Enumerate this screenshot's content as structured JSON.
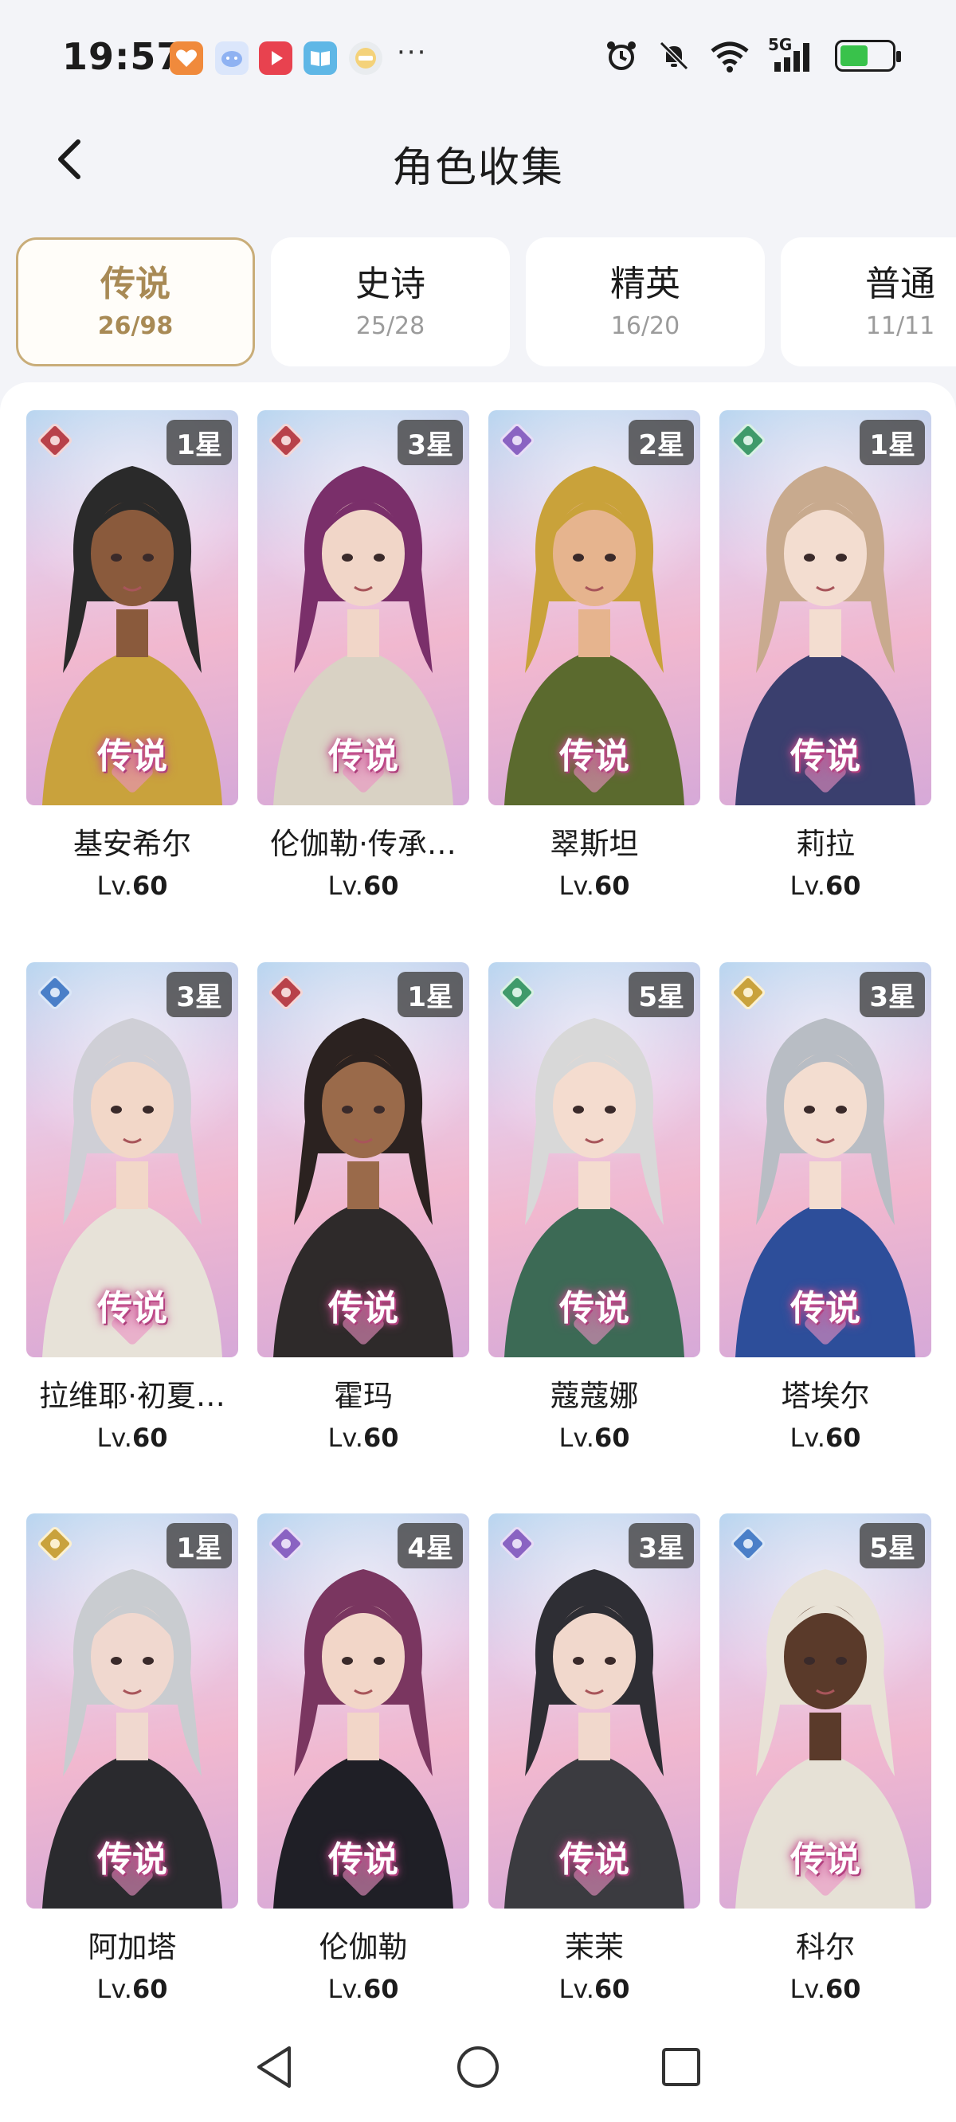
{
  "status_bar": {
    "time": "19:57",
    "notification_icons": [
      "favorite-app-icon",
      "chat-app-icon",
      "video-app-icon",
      "book-app-icon",
      "game-app-icon"
    ],
    "more": "···",
    "signal_label": "5G"
  },
  "header": {
    "title": "角色收集"
  },
  "tabs": [
    {
      "label": "传说",
      "count": "26/98",
      "active": true
    },
    {
      "label": "史诗",
      "count": "25/28",
      "active": false
    },
    {
      "label": "精英",
      "count": "16/20",
      "active": false
    },
    {
      "label": "普通",
      "count": "11/11",
      "active": false
    }
  ],
  "rarity_label": "传说",
  "level_prefix": "Lv.",
  "characters": [
    {
      "name": "基安希尔",
      "stars": "1星",
      "level": "60",
      "element": "crimson",
      "skin": "#8a5a3c",
      "hair": "#2a2a2a",
      "outfit": "#c9a23c"
    },
    {
      "name": "伦伽勒·传承…",
      "stars": "3星",
      "level": "60",
      "element": "crimson",
      "skin": "#f1d6c8",
      "hair": "#7a2f6a",
      "outfit": "#d9d2c4"
    },
    {
      "name": "翠斯坦",
      "stars": "2星",
      "level": "60",
      "element": "violet",
      "skin": "#e6b48e",
      "hair": "#c9a23a",
      "outfit": "#5b6a2e"
    },
    {
      "name": "莉拉",
      "stars": "1星",
      "level": "60",
      "element": "green",
      "skin": "#f3ddd0",
      "hair": "#c8aa8e",
      "outfit": "#3a3f6e"
    },
    {
      "name": "拉维耶·初夏…",
      "stars": "3星",
      "level": "60",
      "element": "blue",
      "skin": "#f2d7c8",
      "hair": "#cfcfd6",
      "outfit": "#e7e2d8"
    },
    {
      "name": "霍玛",
      "stars": "1星",
      "level": "60",
      "element": "crimson",
      "skin": "#9a6a4a",
      "hair": "#2b2220",
      "outfit": "#2e2a2a"
    },
    {
      "name": "蔻蔻娜",
      "stars": "5星",
      "level": "60",
      "element": "green",
      "skin": "#f4dccf",
      "hair": "#d8d8d8",
      "outfit": "#3c6a55"
    },
    {
      "name": "塔埃尔",
      "stars": "3星",
      "level": "60",
      "element": "gold",
      "skin": "#f3ddd0",
      "hair": "#b8bdc4",
      "outfit": "#2d4e9a"
    },
    {
      "name": "阿加塔",
      "stars": "1星",
      "level": "60",
      "element": "gold",
      "skin": "#f0d8cf",
      "hair": "#c9ccd0",
      "outfit": "#2a2a2e"
    },
    {
      "name": "伦伽勒",
      "stars": "4星",
      "level": "60",
      "element": "violet",
      "skin": "#f2d6c8",
      "hair": "#7a3660",
      "outfit": "#1f1f26"
    },
    {
      "name": "茉茉",
      "stars": "3星",
      "level": "60",
      "element": "violet",
      "skin": "#f1d8cc",
      "hair": "#2e2e34",
      "outfit": "#3b3b40"
    },
    {
      "name": "科尔",
      "stars": "5星",
      "level": "60",
      "element": "blue",
      "skin": "#5a3a2a",
      "hair": "#e8e2d6",
      "outfit": "#e6e1d6"
    }
  ],
  "nav_bar": {
    "back": "nav-back-icon",
    "home": "nav-home-icon",
    "recents": "nav-recents-icon"
  }
}
